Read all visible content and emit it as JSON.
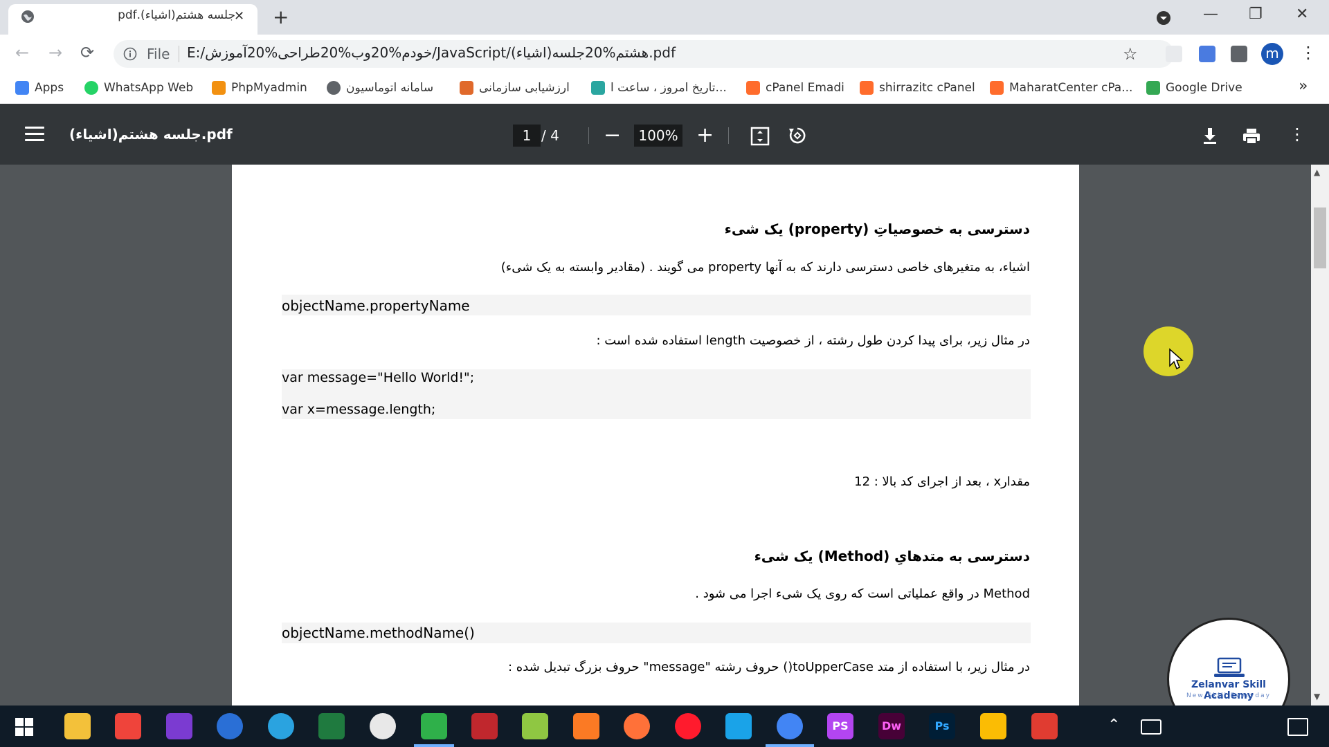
{
  "browser": {
    "tab_title": "جلسه هشتم(اشیاء).pdf",
    "tab_close": "✕",
    "new_tab": "+",
    "window_controls": [
      "—",
      "❐",
      "✕"
    ],
    "address": {
      "scheme": "File",
      "url": "E:/خودم%20وب%20طراحی%20آموزش/JavaScript/(اشیاء)هشتم%20جلسه.pdf"
    },
    "profile_initial": "m",
    "bookmarks": [
      {
        "label": "Apps",
        "icon": "apps-grid-icon",
        "color": "#4285f4"
      },
      {
        "label": "WhatsApp Web",
        "icon": "whatsapp-icon",
        "color": "#25d366"
      },
      {
        "label": "PhpMyadmin",
        "icon": "phpmyadmin-icon",
        "color": "#f29111"
      },
      {
        "label": "سامانه اتوماسیون",
        "icon": "globe-icon",
        "color": "#5f6368"
      },
      {
        "label": "ارزشیابی سازمانی",
        "icon": "evaluation-icon",
        "color": "#e0692b"
      },
      {
        "label": "تاریخ امروز ، ساعت ا...",
        "icon": "calendar-icon",
        "color": "#2aa6a0"
      },
      {
        "label": "cPanel Emadi",
        "icon": "cpanel-icon",
        "color": "#ff6c2c"
      },
      {
        "label": "shirrazitc cPanel",
        "icon": "cpanel-icon",
        "color": "#ff6c2c"
      },
      {
        "label": "MaharatCenter cPa...",
        "icon": "cpanel-icon",
        "color": "#ff6c2c"
      },
      {
        "label": "Google Drive",
        "icon": "google-drive-icon",
        "color": "#34a853"
      }
    ],
    "bookmarks_more": "»"
  },
  "pdf_viewer": {
    "title": "جلسه هشتم(اشیاء).pdf",
    "current_page": "1",
    "page_count": "/  4",
    "zoom": "100%"
  },
  "document": {
    "h_property": "دسترسی به خصوصیاتِ (property) یک شیء",
    "p_property": "اشیاء، به متغیرهای خاصی دسترسی دارند که به آنها property می گویند . (مقادیر وابسته به یک شیء)",
    "code_property": "objectName.propertyName",
    "p_length": "در مثال زیر، برای پیدا کردن طول رشته ، از خصوصیت length استفاده شده است :",
    "code_line1": "var message=\"Hello World!\";",
    "code_line2": "var x=message.length;",
    "p_x_value": "مقدارx ، بعد از اجرای کد بالا :  12",
    "h_method": "دسترسی به متدهایِ (Method) یک شیء",
    "p_method": "Method در واقع عملیاتی است که روی یک شیء اجرا می شود .",
    "code_method": "objectName.methodName()",
    "p_upper": "در مثال زیر، با استفاده از متد toUpperCase() حروف رشته  \"message\" حروف بزرگ تبدیل شده :"
  },
  "watermark": {
    "title": "Zelanvar Skill Academy",
    "subtitle": "New Skill Everyday"
  },
  "taskbar": {
    "apps": [
      {
        "name": "start-button",
        "color": "#ffffff"
      },
      {
        "name": "file-explorer",
        "color": "#f3c13a"
      },
      {
        "name": "anydesk",
        "color": "#ef443b"
      },
      {
        "name": "visual-studio",
        "color": "#7b3bd1"
      },
      {
        "name": "ccleaner",
        "color": "#2a6fd6"
      },
      {
        "name": "telegram",
        "color": "#2aa3e0"
      },
      {
        "name": "app-green",
        "color": "#1f7a3f"
      },
      {
        "name": "app-circle",
        "color": "#e8e8e8"
      },
      {
        "name": "camtasia",
        "color": "#2fb04a"
      },
      {
        "name": "filezilla",
        "color": "#c0272d"
      },
      {
        "name": "notepad-plus",
        "color": "#8fc742"
      },
      {
        "name": "xampp",
        "color": "#fb7a24"
      },
      {
        "name": "firefox",
        "color": "#ff7139"
      },
      {
        "name": "opera",
        "color": "#ff1b2d"
      },
      {
        "name": "app-blue",
        "color": "#1aa3e8"
      },
      {
        "name": "chrome",
        "color": "#4285f4"
      },
      {
        "name": "phpstorm",
        "color": "#b345f1",
        "label": "PS"
      },
      {
        "name": "dreamweaver",
        "color": "#470137",
        "label": "Dw"
      },
      {
        "name": "photoshop",
        "color": "#001e36",
        "label": "Ps"
      },
      {
        "name": "google-drive",
        "color": "#fbbc04"
      },
      {
        "name": "camtasia-red",
        "color": "#e03c31"
      }
    ]
  }
}
